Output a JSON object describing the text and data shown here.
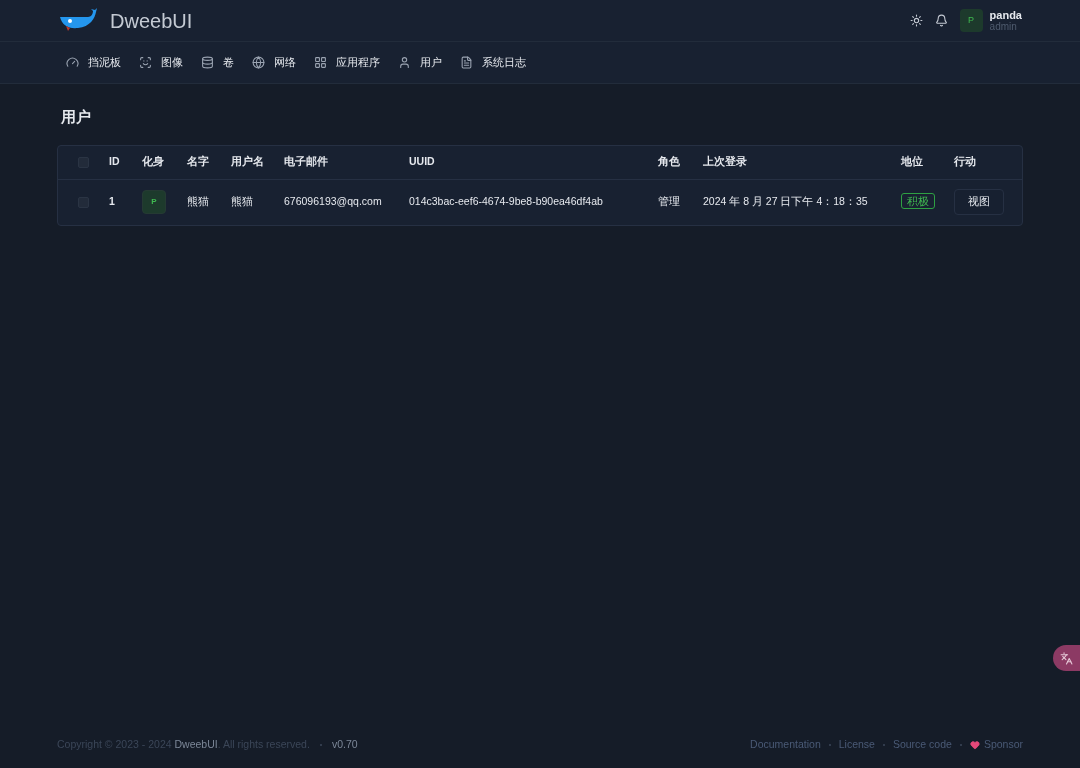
{
  "header": {
    "brand": "DweebUI",
    "user": {
      "avatar": "P",
      "name": "panda",
      "role": "admin"
    }
  },
  "nav": [
    {
      "label": "挡泥板"
    },
    {
      "label": "图像"
    },
    {
      "label": "卷"
    },
    {
      "label": "网络"
    },
    {
      "label": "应用程序"
    },
    {
      "label": "用户"
    },
    {
      "label": "系统日志"
    }
  ],
  "page_title": "用户",
  "table": {
    "select_all_checked": false,
    "columns": [
      "ID",
      "化身",
      "名字",
      "用户名",
      "电子邮件",
      "UUID",
      "角色",
      "上次登录",
      "地位",
      "行动"
    ],
    "rows": [
      {
        "checked": false,
        "id": "1",
        "avatar": "P",
        "name": "熊猫",
        "username": "熊猫",
        "email": "676096193@qq.com",
        "uuid": "014c3bac-eef6-4674-9be8-b90ea46df4ab",
        "role": "管理",
        "last_login": "2024 年 8 月 27 日下午 4：18：35",
        "status": "积极",
        "action": "视图"
      }
    ]
  },
  "footer": {
    "copyright_prefix": "Copyright © 2023 - 2024",
    "brand": "DweebUI",
    "copyright_suffix": ". All rights reserved.",
    "version": "v0.70",
    "links": [
      "Documentation",
      "License",
      "Source code",
      "Sponsor"
    ]
  }
}
